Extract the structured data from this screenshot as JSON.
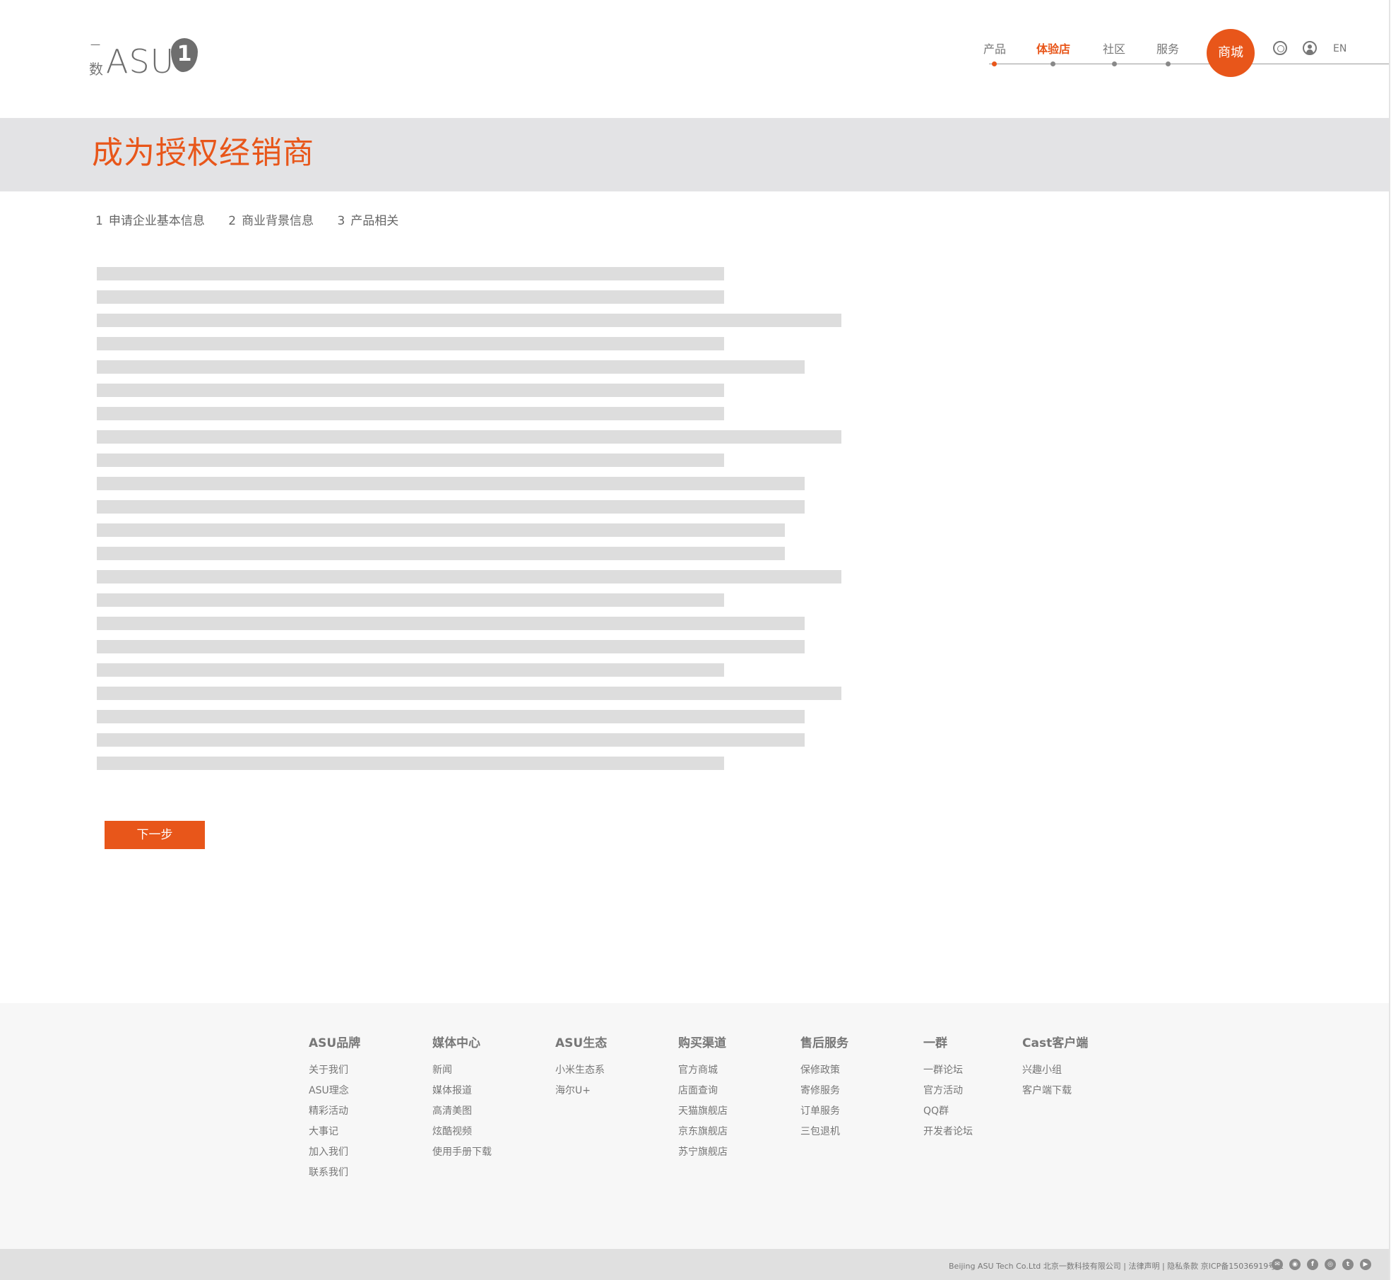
{
  "logo": {
    "yi": "一",
    "shu": "数",
    "brand": "ASU",
    "badge": "1"
  },
  "nav": [
    {
      "label": "产品",
      "active": false
    },
    {
      "label": "体验店",
      "active": true
    },
    {
      "label": "社区",
      "active": false
    },
    {
      "label": "服务",
      "active": false
    }
  ],
  "shop_label": "商城",
  "lang_label": "EN",
  "page_title": "成为授权经销商",
  "steps": [
    {
      "num": "1",
      "label": "申请企业基本信息"
    },
    {
      "num": "2",
      "label": "商业背景信息"
    },
    {
      "num": "3",
      "label": "产品相关"
    }
  ],
  "next_button": "下一步",
  "footer": {
    "columns": [
      {
        "title": "ASU品牌",
        "links": [
          "关于我们",
          "ASU理念",
          "精彩活动",
          "大事记",
          "加入我们",
          "联系我们"
        ]
      },
      {
        "title": "媒体中心",
        "links": [
          "新闻",
          "媒体报道",
          "高清美图",
          "炫酷视频",
          "使用手册下载"
        ]
      },
      {
        "title": "ASU生态",
        "links": [
          "小米生态系",
          "海尔U+"
        ]
      },
      {
        "title": "购买渠道",
        "links": [
          "官方商城",
          "店面查询",
          "天猫旗舰店",
          "京东旗舰店",
          "苏宁旗舰店"
        ]
      },
      {
        "title": "售后服务",
        "links": [
          "保修政策",
          "寄修服务",
          "订单服务",
          "三包退机"
        ]
      },
      {
        "title": "一群",
        "links": [
          "一群论坛",
          "官方活动",
          "QQ群",
          "开发者论坛"
        ]
      },
      {
        "title": "Cast客户端",
        "links": [
          "兴趣小组",
          "客户端下载"
        ]
      }
    ],
    "copyright": "Beijing ASU Tech Co.Ltd 北京一数科技有限公司 | 法律声明 | 隐私条款  京ICP备15036919号-1"
  },
  "social_icons": [
    "email-icon",
    "wechat-icon",
    "facebook-icon",
    "weibo-icon",
    "twitter-icon",
    "youtube-icon"
  ],
  "colors": {
    "accent": "#e8561a",
    "banner_bg": "#e3e3e5",
    "placeholder": "#dddddd",
    "footer_bg": "#f7f7f7",
    "bottom_bar": "#e0e0e0"
  }
}
